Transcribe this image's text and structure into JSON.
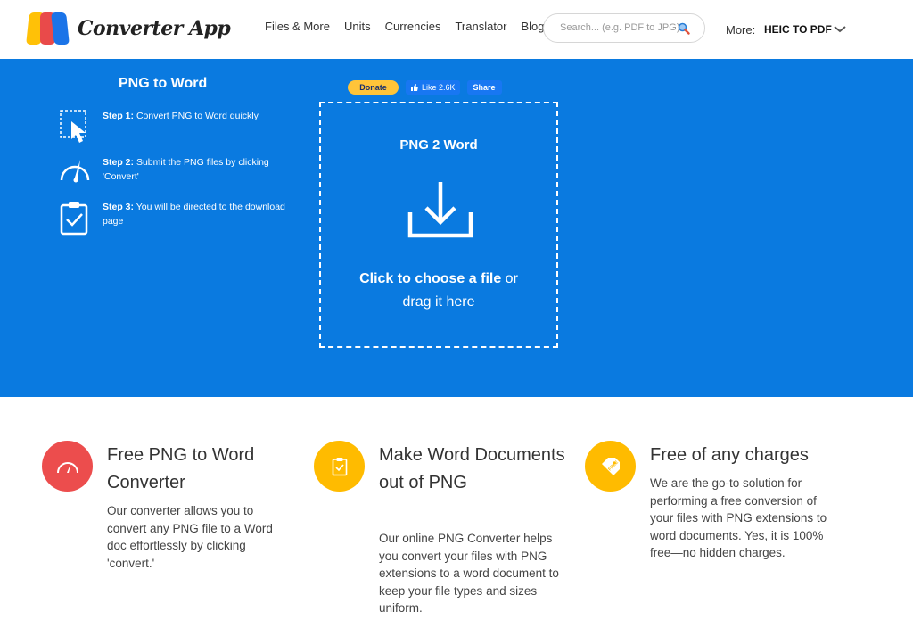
{
  "header": {
    "logo_text": "Converter App",
    "nav": [
      "Files & More",
      "Units",
      "Currencies",
      "Translator",
      "Blog"
    ],
    "search_placeholder": "Search... (e.g. PDF to JPG)",
    "more_label": "More:",
    "more_selected": "HEIC TO PDF"
  },
  "hero": {
    "steps_title": "PNG to Word",
    "steps": [
      {
        "label": "Step 1:",
        "text": "Convert PNG to Word quickly",
        "icon": "cursor-icon"
      },
      {
        "label": "Step 2:",
        "text": "Submit the PNG files by clicking 'Convert'",
        "icon": "speedometer-icon"
      },
      {
        "label": "Step 3:",
        "text": "You will be directed to the download page",
        "icon": "clipboard-check-icon"
      }
    ],
    "donate_label": "Donate",
    "like_label": "Like 2.6K",
    "share_label": "Share",
    "dropzone": {
      "title": "PNG 2 Word",
      "cta_bold": "Click to choose a file",
      "cta_rest": " or",
      "cta_line2": "drag it here"
    }
  },
  "features": [
    {
      "title": "Free PNG to Word Converter",
      "body": "Our converter allows you to convert any PNG file to a Word doc effortlessly by clicking 'convert.'",
      "icon": "speedometer-icon"
    },
    {
      "title": "Make Word Documents out of PNG",
      "body": "Our online PNG Converter helps you convert your files with PNG extensions to a word document to keep your file types and sizes uniform.",
      "icon": "clipboard-check-icon"
    },
    {
      "title": "Free of any charges",
      "body": "We are the go-to solution for performing a free conversion of your files with PNG extensions to word documents. Yes, it is 100% free—no hidden charges.",
      "icon": "free-tag-icon"
    }
  ],
  "colors": {
    "hero_bg": "#0a7ae0",
    "feature_red": "#ec4d4d",
    "feature_yellow": "#ffbb00"
  }
}
